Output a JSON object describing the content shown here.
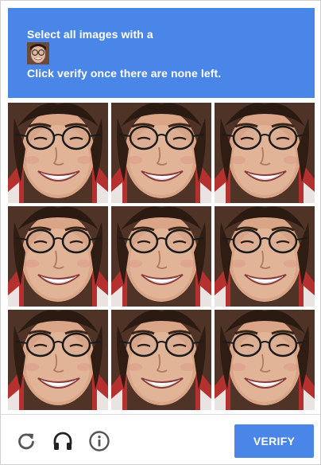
{
  "instructions": {
    "line1": "Select all images with a",
    "line2": "Click verify once there are none left."
  },
  "grid": {
    "rows": 3,
    "cols": 3,
    "tiles": [
      "face",
      "face",
      "face",
      "face",
      "face",
      "face",
      "face",
      "face",
      "face"
    ]
  },
  "footer": {
    "icons": [
      "reload-icon",
      "headphones-icon",
      "info-icon"
    ],
    "verify_label": "VERIFY"
  },
  "colors": {
    "accent": "#4a86e8",
    "icon_gray": "#555555"
  }
}
